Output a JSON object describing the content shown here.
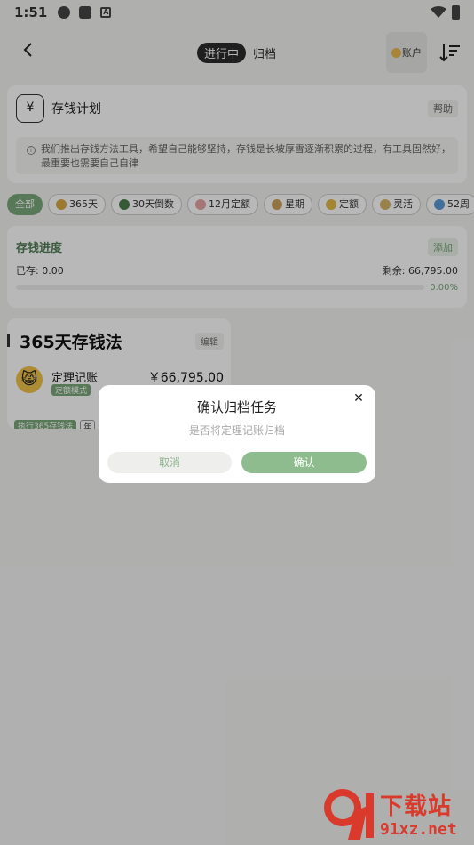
{
  "status_bar": {
    "time": "1:51"
  },
  "nav": {
    "tabs": [
      {
        "label": "进行中",
        "active": true
      },
      {
        "label": "归档",
        "active": false
      }
    ],
    "account_label": "账户"
  },
  "plan": {
    "icon_glyph": "¥",
    "title": "存钱计划",
    "help_label": "帮助",
    "description": "我们推出存钱方法工具，希望自己能够坚持，存钱是长坡厚雪逐渐积累的过程，有工具固然好，最重要也需要自己自律"
  },
  "filter_chips": [
    {
      "label": "全部",
      "active": true,
      "has_icon": false
    },
    {
      "label": "365天",
      "active": false,
      "has_icon": true
    },
    {
      "label": "30天倒数",
      "active": false,
      "has_icon": true
    },
    {
      "label": "12月定额",
      "active": false,
      "has_icon": true
    },
    {
      "label": "星期",
      "active": false,
      "has_icon": true
    },
    {
      "label": "定额",
      "active": false,
      "has_icon": true
    },
    {
      "label": "灵活",
      "active": false,
      "has_icon": true
    },
    {
      "label": "52周",
      "active": false,
      "has_icon": true
    },
    {
      "label": "",
      "active": false,
      "has_icon": true
    }
  ],
  "progress": {
    "title": "存钱进度",
    "add_label": "添加",
    "saved": "已存: 0.00",
    "remaining": "剩余: 66,795.00",
    "percent": "0.00%",
    "fraction": 0.0
  },
  "method_card": {
    "title": "365天存钱法",
    "edit_label": "编辑",
    "account_name": "定理记账",
    "mode_tag": "定额模式",
    "amount": "￥66,795.00",
    "avatar_glyph": "😸",
    "bottom_tags": [
      "执行365存钱法",
      "年",
      "天"
    ]
  },
  "dialog": {
    "title": "确认归档任务",
    "subtitle": "是否将定理记账归档",
    "cancel_label": "取消",
    "confirm_label": "确认",
    "close_glyph": "✕"
  },
  "watermark": {
    "title": "下载站",
    "url": "91xz.net"
  },
  "colors": {
    "accent": "#7aa87a",
    "brand_red": "#d93a2c"
  }
}
